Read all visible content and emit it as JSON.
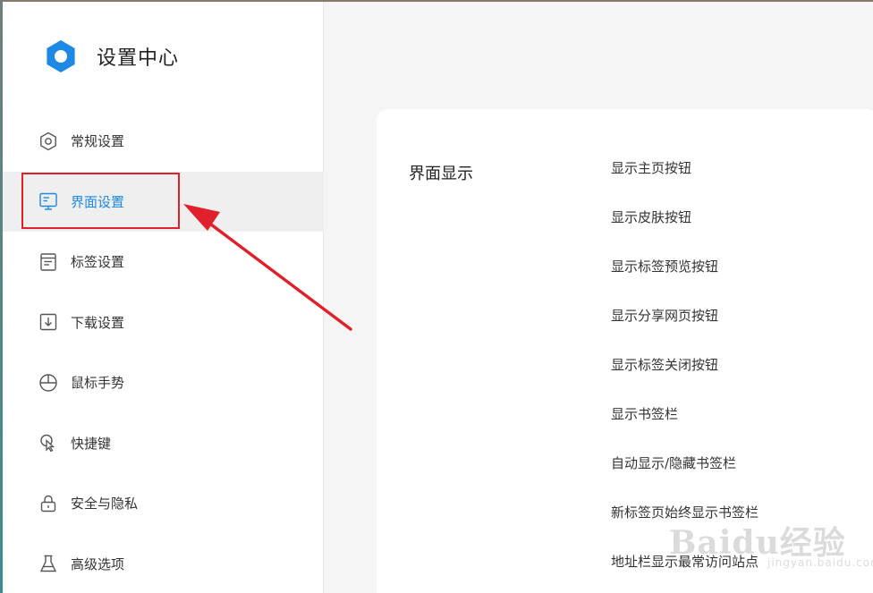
{
  "app": {
    "title": "设置中心"
  },
  "sidebar": {
    "items": [
      {
        "label": "常规设置",
        "icon": "general-settings-icon"
      },
      {
        "label": "界面设置",
        "icon": "interface-settings-icon",
        "active": true
      },
      {
        "label": "标签设置",
        "icon": "tab-settings-icon"
      },
      {
        "label": "下载设置",
        "icon": "download-icon"
      },
      {
        "label": "鼠标手势",
        "icon": "mouse-icon"
      },
      {
        "label": "快捷键",
        "icon": "shortcut-icon"
      },
      {
        "label": "安全与隐私",
        "icon": "lock-icon"
      },
      {
        "label": "高级选项",
        "icon": "flask-icon"
      }
    ]
  },
  "main": {
    "section_title": "界面显示",
    "options": [
      "显示主页按钮",
      "显示皮肤按钮",
      "显示标签预览按钮",
      "显示分享网页按钮",
      "显示标签关闭按钮",
      "显示书签栏",
      "自动显示/隐藏书签栏",
      "新标签页始终显示书签栏",
      "地址栏显示最常访问站点"
    ]
  },
  "watermark": {
    "text": "Baidu经验",
    "sub": "jingyan.baidu.com"
  },
  "colors": {
    "accent": "#1e88e5",
    "annotation": "#e0202a"
  }
}
